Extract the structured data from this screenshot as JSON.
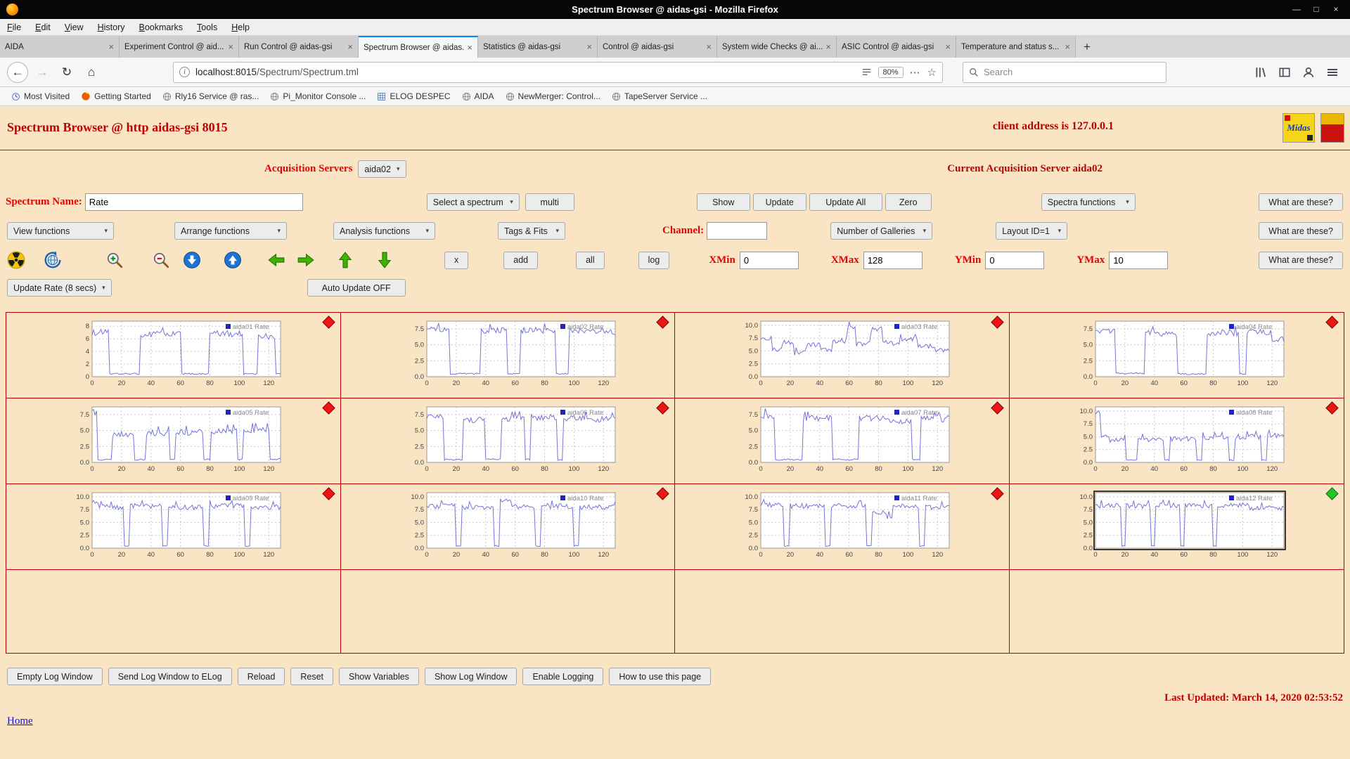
{
  "window": {
    "title": "Spectrum Browser @ aidas-gsi - Mozilla Firefox"
  },
  "icons": {
    "minimize": "—",
    "maximize": "□",
    "close": "×",
    "back": "←",
    "forward": "→",
    "reload": "↻",
    "home": "⌂",
    "caret": "▾",
    "dots": "⋯",
    "star": "☆",
    "info": "i",
    "plus": "+"
  },
  "menubar": {
    "items": [
      "File",
      "Edit",
      "View",
      "History",
      "Bookmarks",
      "Tools",
      "Help"
    ]
  },
  "tabs": [
    {
      "label": "AIDA",
      "active": false
    },
    {
      "label": "Experiment Control @ aid...",
      "active": false
    },
    {
      "label": "Run Control @ aidas-gsi",
      "active": false
    },
    {
      "label": "Spectrum Browser @ aidas...",
      "active": true
    },
    {
      "label": "Statistics @ aidas-gsi",
      "active": false
    },
    {
      "label": "Control @ aidas-gsi",
      "active": false
    },
    {
      "label": "System wide Checks @ ai...",
      "active": false
    },
    {
      "label": "ASIC Control @ aidas-gsi",
      "active": false
    },
    {
      "label": "Temperature and status s...",
      "active": false
    }
  ],
  "urlbar": {
    "host": "localhost:8015",
    "path": "/Spectrum/Spectrum.tml",
    "zoom": "80%",
    "search_placeholder": "Search"
  },
  "bookmarks": [
    {
      "label": "Most Visited",
      "icon": "clock"
    },
    {
      "label": "Getting Started",
      "icon": "firefox"
    },
    {
      "label": "Rly16 Service @ ras...",
      "icon": "globe"
    },
    {
      "label": "Pi_Monitor Console ...",
      "icon": "globe"
    },
    {
      "label": "ELOG DESPEC",
      "icon": "grid"
    },
    {
      "label": "AIDA",
      "icon": "globe"
    },
    {
      "label": "NewMerger: Control...",
      "icon": "globe"
    },
    {
      "label": "TapeServer Service ...",
      "icon": "globe"
    }
  ],
  "page": {
    "title": "Spectrum Browser @ http aidas-gsi 8015",
    "client_address": "client address is 127.0.0.1",
    "midas_logo_text": "Midas",
    "acq_servers_label": "Acquisition Servers",
    "acq_server_value": "aida02",
    "current_server": "Current Acquisition Server aida02",
    "spectrum_name_label": "Spectrum Name:",
    "spectrum_name_value": "Rate",
    "select_spectrum": "Select a spectrum",
    "multi_label": "multi",
    "show_label": "Show",
    "update_label": "Update",
    "update_all_label": "Update All",
    "zero_label": "Zero",
    "spectra_functions": "Spectra functions",
    "what_are_these": "What are these?",
    "view_functions": "View functions",
    "arrange_functions": "Arrange functions",
    "analysis_functions": "Analysis functions",
    "tags_fits": "Tags & Fits",
    "channel_label": "Channel:",
    "number_of_galleries": "Number of Galleries",
    "layout_id": "Layout ID=1",
    "tool_icons": [
      "radiation-icon",
      "refresh-globe-icon",
      "zoom-in-icon",
      "zoom-out-icon",
      "circle-down-arrow-icon",
      "circle-up-arrow-icon",
      "green-left-arrow-icon",
      "green-right-arrow-icon",
      "green-up-arrow-icon",
      "green-down-arrow-icon"
    ],
    "small_buttons": [
      "x",
      "add",
      "all",
      "log"
    ],
    "axis_fields": [
      {
        "label": "XMin",
        "value": "0"
      },
      {
        "label": "XMax",
        "value": "128"
      },
      {
        "label": "YMin",
        "value": "0"
      },
      {
        "label": "YMax",
        "value": "10"
      }
    ],
    "update_rate": "Update Rate (8 secs)",
    "auto_update": "Auto Update OFF",
    "footer_buttons": [
      "Empty Log Window",
      "Send Log Window to ELog",
      "Reload",
      "Reset",
      "Show Variables",
      "Show Log Window",
      "Enable Logging"
    ],
    "how_to_use": "How to use this page",
    "last_updated": "Last Updated: March 14, 2020 02:53:52",
    "home_link": "Home"
  },
  "chart_data": {
    "type": "line",
    "common": {
      "xlim": [
        0,
        128
      ],
      "xticks": [
        0,
        20,
        40,
        60,
        80,
        100,
        120
      ],
      "line_color": "#7474d8",
      "legend_color": "#2222cc",
      "grid": true,
      "legend_position": "top-right"
    },
    "plots": [
      {
        "name": "aida01 Rate",
        "yticks": [
          0,
          2,
          4,
          6,
          8
        ],
        "ymax": 8.8,
        "marker": "red",
        "selected": false,
        "segments": [
          [
            0,
            11,
            7.0
          ],
          [
            11,
            32,
            0.45
          ],
          [
            32,
            60,
            6.7
          ],
          [
            60,
            79,
            0.45
          ],
          [
            79,
            102,
            6.8
          ],
          [
            102,
            112,
            0.45
          ],
          [
            112,
            124,
            6.4
          ],
          [
            124,
            128,
            0.4
          ]
        ]
      },
      {
        "name": "aida02 Rate",
        "yticks": [
          0,
          2.5,
          5,
          7.5
        ],
        "ymax": 8.7,
        "marker": "red",
        "selected": false,
        "segments": [
          [
            0,
            4,
            7.9
          ],
          [
            4,
            15,
            7.3
          ],
          [
            15,
            36,
            0.45
          ],
          [
            36,
            54,
            7.2
          ],
          [
            54,
            63,
            0.45
          ],
          [
            63,
            87,
            7.3
          ],
          [
            87,
            96,
            0.45
          ],
          [
            96,
            120,
            7.2
          ],
          [
            120,
            128,
            6.9
          ]
        ]
      },
      {
        "name": "aida03 Rate",
        "yticks": [
          0,
          2.5,
          5,
          7.5,
          10
        ],
        "ymax": 10.8,
        "marker": "red",
        "selected": false,
        "segments": [
          [
            0,
            7,
            7.6
          ],
          [
            7,
            14,
            5.2
          ],
          [
            14,
            22,
            6.6
          ],
          [
            22,
            30,
            4.6
          ],
          [
            30,
            40,
            6.2
          ],
          [
            40,
            48,
            5.4
          ],
          [
            48,
            58,
            7.0
          ],
          [
            58,
            64,
            9.6
          ],
          [
            64,
            74,
            6.4
          ],
          [
            74,
            82,
            9.2
          ],
          [
            82,
            94,
            6.6
          ],
          [
            94,
            106,
            7.2
          ],
          [
            106,
            118,
            6.0
          ],
          [
            118,
            128,
            5.2
          ]
        ]
      },
      {
        "name": "aida04 Rate",
        "yticks": [
          0,
          2.5,
          5,
          7.5
        ],
        "ymax": 8.7,
        "marker": "red",
        "selected": false,
        "segments": [
          [
            0,
            13,
            7.2
          ],
          [
            13,
            33,
            0.5
          ],
          [
            33,
            55,
            6.8
          ],
          [
            55,
            75,
            0.45
          ],
          [
            75,
            97,
            6.9
          ],
          [
            97,
            102,
            0.45
          ],
          [
            102,
            119,
            7.0
          ],
          [
            119,
            128,
            5.9
          ]
        ]
      },
      {
        "name": "aida05 Rate",
        "yticks": [
          0,
          2.5,
          5,
          7.5
        ],
        "ymax": 8.7,
        "marker": "red",
        "selected": false,
        "segments": [
          [
            0,
            3,
            7.9
          ],
          [
            3,
            13,
            0.45
          ],
          [
            13,
            28,
            4.4
          ],
          [
            28,
            36,
            0.45
          ],
          [
            36,
            52,
            4.6
          ],
          [
            52,
            56,
            0.45
          ],
          [
            56,
            75,
            4.7
          ],
          [
            75,
            80,
            0.45
          ],
          [
            80,
            98,
            4.9
          ],
          [
            98,
            102,
            0.45
          ],
          [
            102,
            120,
            5.1
          ],
          [
            120,
            128,
            0.5
          ]
        ]
      },
      {
        "name": "aida06 Rate",
        "yticks": [
          0,
          2.5,
          5,
          7.5
        ],
        "ymax": 8.7,
        "marker": "red",
        "selected": false,
        "segments": [
          [
            0,
            11,
            7.3
          ],
          [
            11,
            24,
            0.45
          ],
          [
            24,
            39,
            6.7
          ],
          [
            39,
            50,
            0.5
          ],
          [
            50,
            66,
            6.9
          ],
          [
            66,
            70,
            0.45
          ],
          [
            70,
            88,
            7.1
          ],
          [
            88,
            92,
            0.45
          ],
          [
            92,
            110,
            6.9
          ],
          [
            110,
            128,
            6.7
          ]
        ]
      },
      {
        "name": "aida07 Rate",
        "yticks": [
          0,
          2.5,
          5,
          7.5
        ],
        "ymax": 8.7,
        "marker": "red",
        "selected": false,
        "segments": [
          [
            0,
            9,
            7.4
          ],
          [
            9,
            28,
            0.45
          ],
          [
            28,
            48,
            6.9
          ],
          [
            48,
            66,
            0.45
          ],
          [
            66,
            86,
            7.0
          ],
          [
            86,
            102,
            6.5
          ],
          [
            102,
            108,
            0.45
          ],
          [
            108,
            128,
            6.8
          ]
        ]
      },
      {
        "name": "aida08 Rate",
        "yticks": [
          0,
          2.5,
          5,
          7.5,
          10
        ],
        "ymax": 10.8,
        "marker": "red",
        "selected": false,
        "segments": [
          [
            0,
            3,
            9.6
          ],
          [
            3,
            9,
            5.2
          ],
          [
            9,
            20,
            4.3
          ],
          [
            20,
            28,
            0.45
          ],
          [
            28,
            46,
            4.5
          ],
          [
            46,
            50,
            0.45
          ],
          [
            50,
            68,
            4.6
          ],
          [
            68,
            72,
            0.45
          ],
          [
            72,
            90,
            4.8
          ],
          [
            90,
            94,
            0.45
          ],
          [
            94,
            112,
            5.0
          ],
          [
            112,
            116,
            0.45
          ],
          [
            116,
            128,
            5.2
          ]
        ]
      },
      {
        "name": "aida09 Rate",
        "yticks": [
          0,
          2.5,
          5,
          7.5,
          10
        ],
        "ymax": 10.8,
        "marker": "red",
        "selected": false,
        "segments": [
          [
            0,
            4,
            9.1
          ],
          [
            4,
            21,
            8.0
          ],
          [
            21,
            25,
            0.45
          ],
          [
            25,
            47,
            8.2
          ],
          [
            47,
            51,
            0.45
          ],
          [
            51,
            75,
            8.0
          ],
          [
            75,
            79,
            0.45
          ],
          [
            79,
            103,
            8.2
          ],
          [
            103,
            107,
            0.45
          ],
          [
            107,
            128,
            8.0
          ]
        ]
      },
      {
        "name": "aida10 Rate",
        "yticks": [
          0,
          2.5,
          5,
          7.5,
          10
        ],
        "ymax": 10.8,
        "marker": "red",
        "selected": false,
        "segments": [
          [
            0,
            19,
            8.2
          ],
          [
            19,
            23,
            0.45
          ],
          [
            23,
            45,
            8.0
          ],
          [
            45,
            49,
            0.45
          ],
          [
            49,
            57,
            9.4
          ],
          [
            57,
            73,
            8.0
          ],
          [
            73,
            77,
            0.45
          ],
          [
            77,
            99,
            8.2
          ],
          [
            99,
            103,
            0.45
          ],
          [
            103,
            128,
            8.0
          ]
        ]
      },
      {
        "name": "aida11 Rate",
        "yticks": [
          0,
          2.5,
          5,
          7.5,
          10
        ],
        "ymax": 10.8,
        "marker": "red",
        "selected": false,
        "segments": [
          [
            0,
            15,
            8.4
          ],
          [
            15,
            19,
            0.45
          ],
          [
            19,
            43,
            8.2
          ],
          [
            43,
            47,
            0.45
          ],
          [
            47,
            71,
            8.2
          ],
          [
            71,
            75,
            0.45
          ],
          [
            75,
            85,
            7.0
          ],
          [
            85,
            89,
            6.1
          ],
          [
            89,
            107,
            8.2
          ],
          [
            107,
            111,
            0.45
          ],
          [
            111,
            128,
            8.0
          ]
        ]
      },
      {
        "name": "aida12 Rate",
        "yticks": [
          0,
          2.5,
          5,
          7.5,
          10
        ],
        "ymax": 10.8,
        "marker": "green",
        "selected": true,
        "segments": [
          [
            0,
            17,
            8.3
          ],
          [
            17,
            20,
            0.45
          ],
          [
            20,
            37,
            8.2
          ],
          [
            37,
            40,
            0.45
          ],
          [
            40,
            57,
            8.3
          ],
          [
            57,
            60,
            0.45
          ],
          [
            60,
            79,
            8.2
          ],
          [
            79,
            82,
            0.45
          ],
          [
            82,
            104,
            8.4
          ],
          [
            104,
            128,
            7.8
          ]
        ]
      }
    ]
  }
}
